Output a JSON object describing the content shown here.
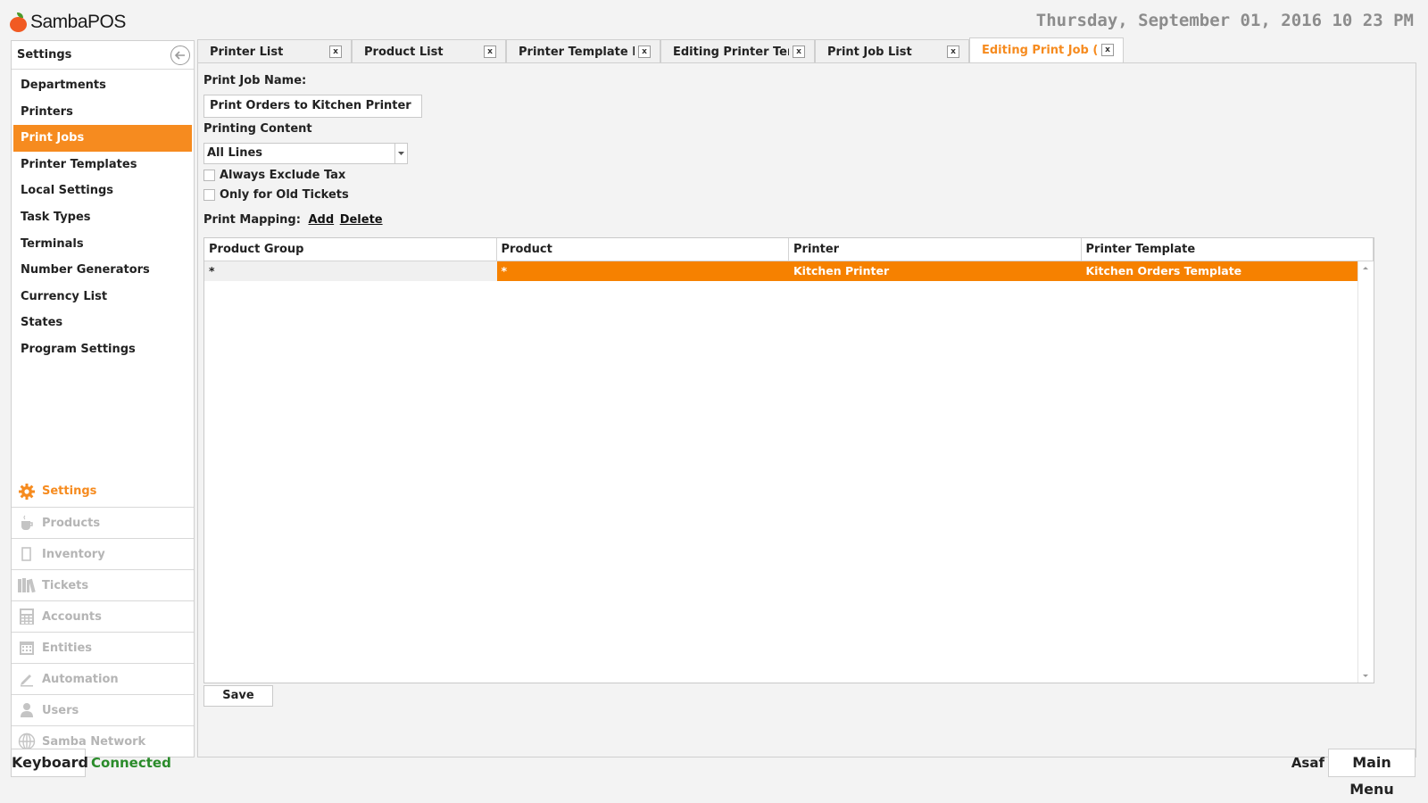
{
  "app": {
    "logo_text": "SambaPOS"
  },
  "clock": "Thursday, September 01, 2016 10 23 PM",
  "colors": {
    "accent": "#f68b1f",
    "connected": "#2a8b2a",
    "muted": "#b5b5b5"
  },
  "sidebar": {
    "title": "Settings",
    "items": [
      {
        "label": "Departments"
      },
      {
        "label": "Printers"
      },
      {
        "label": "Print Jobs",
        "active": true
      },
      {
        "label": "Printer Templates"
      },
      {
        "label": "Local Settings"
      },
      {
        "label": "Task Types"
      },
      {
        "label": "Terminals"
      },
      {
        "label": "Number Generators"
      },
      {
        "label": "Currency List"
      },
      {
        "label": "States"
      },
      {
        "label": "Program Settings"
      }
    ],
    "modules": [
      {
        "label": "Settings",
        "icon": "gear-icon",
        "active": true
      },
      {
        "label": "Products",
        "icon": "cup-icon"
      },
      {
        "label": "Inventory",
        "icon": "box-icon"
      },
      {
        "label": "Tickets",
        "icon": "books-icon"
      },
      {
        "label": "Accounts",
        "icon": "calculator-icon"
      },
      {
        "label": "Entities",
        "icon": "calendar-icon"
      },
      {
        "label": "Automation",
        "icon": "pen-icon"
      },
      {
        "label": "Users",
        "icon": "user-icon"
      },
      {
        "label": "Samba Network",
        "icon": "globe-icon"
      }
    ]
  },
  "tabs": [
    {
      "label": "Printer List",
      "close": "x"
    },
    {
      "label": "Product List",
      "close": "x"
    },
    {
      "label": "Printer Template List",
      "close": "x"
    },
    {
      "label": "Editing Printer Template",
      "close": "x"
    },
    {
      "label": "Print Job List",
      "close": "x"
    },
    {
      "label": "Editing Print Job (Print Orders to Kitchen Printer)",
      "close": "x",
      "active": true
    }
  ],
  "form": {
    "name_label": "Print Job Name:",
    "name_value": "Print Orders to Kitchen Printer",
    "content_label": "Printing Content",
    "content_value": "All Lines",
    "exclude_tax_label": "Always Exclude Tax",
    "old_tickets_label": "Only for Old Tickets",
    "mapping_label": "Print Mapping:",
    "add_label": "Add",
    "delete_label": "Delete",
    "save_label": "Save"
  },
  "grid": {
    "columns": [
      "Product Group",
      "Product",
      "Printer",
      "Printer Template"
    ],
    "rows": [
      [
        "*",
        "*",
        "Kitchen Printer",
        "Kitchen Orders Template"
      ]
    ]
  },
  "footer": {
    "keyboard_label": "Keyboard",
    "status": "Connected",
    "user": "Asaf",
    "main_menu_label": "Main Menu"
  }
}
